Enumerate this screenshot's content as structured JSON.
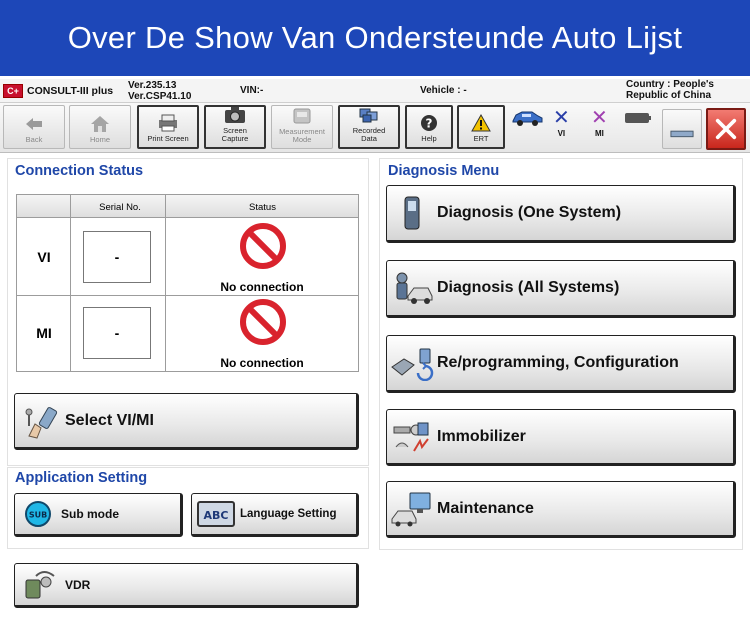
{
  "banner": {
    "title": "Over De Show Van Ondersteunde Auto Lijst"
  },
  "titlebar": {
    "logo": "C+",
    "app_name": "CONSULT-III plus",
    "version_line1": "Ver.235.13",
    "version_line2": "Ver.CSP41.10",
    "vin": "VIN:-",
    "vehicle": "Vehicle : -",
    "country_line1": "Country : People's",
    "country_line2": "Republic of China"
  },
  "toolbar": {
    "back": "Back",
    "home": "Home",
    "print_screen": "Print Screen",
    "screen_capture_1": "Screen",
    "screen_capture_2": "Capture",
    "measurement_1": "Measurement",
    "measurement_2": "Mode",
    "recorded_1": "Recorded",
    "recorded_2": "Data",
    "help": "Help",
    "ert": "ERT",
    "vi": "VI",
    "mi": "MI"
  },
  "connection": {
    "title": "Connection Status",
    "col_serial": "Serial No.",
    "col_status": "Status",
    "rows": [
      {
        "label": "VI",
        "serial": "-",
        "status": "No connection"
      },
      {
        "label": "MI",
        "serial": "-",
        "status": "No connection"
      }
    ],
    "select_button": "Select VI/MI"
  },
  "application": {
    "title": "Application Setting",
    "sub_mode": "Sub mode",
    "sub_icon": "SUB",
    "language": "Language Setting",
    "language_icon": "ABC",
    "vdr": "VDR"
  },
  "diagnosis": {
    "title": "Diagnosis Menu",
    "items": [
      "Diagnosis (One System)",
      "Diagnosis (All Systems)",
      "Re/programming, Configuration",
      "Immobilizer",
      "Maintenance"
    ]
  },
  "colors": {
    "banner": "#1d47b8",
    "section_title": "#1f47a8",
    "no_connection": "#d9232d"
  }
}
